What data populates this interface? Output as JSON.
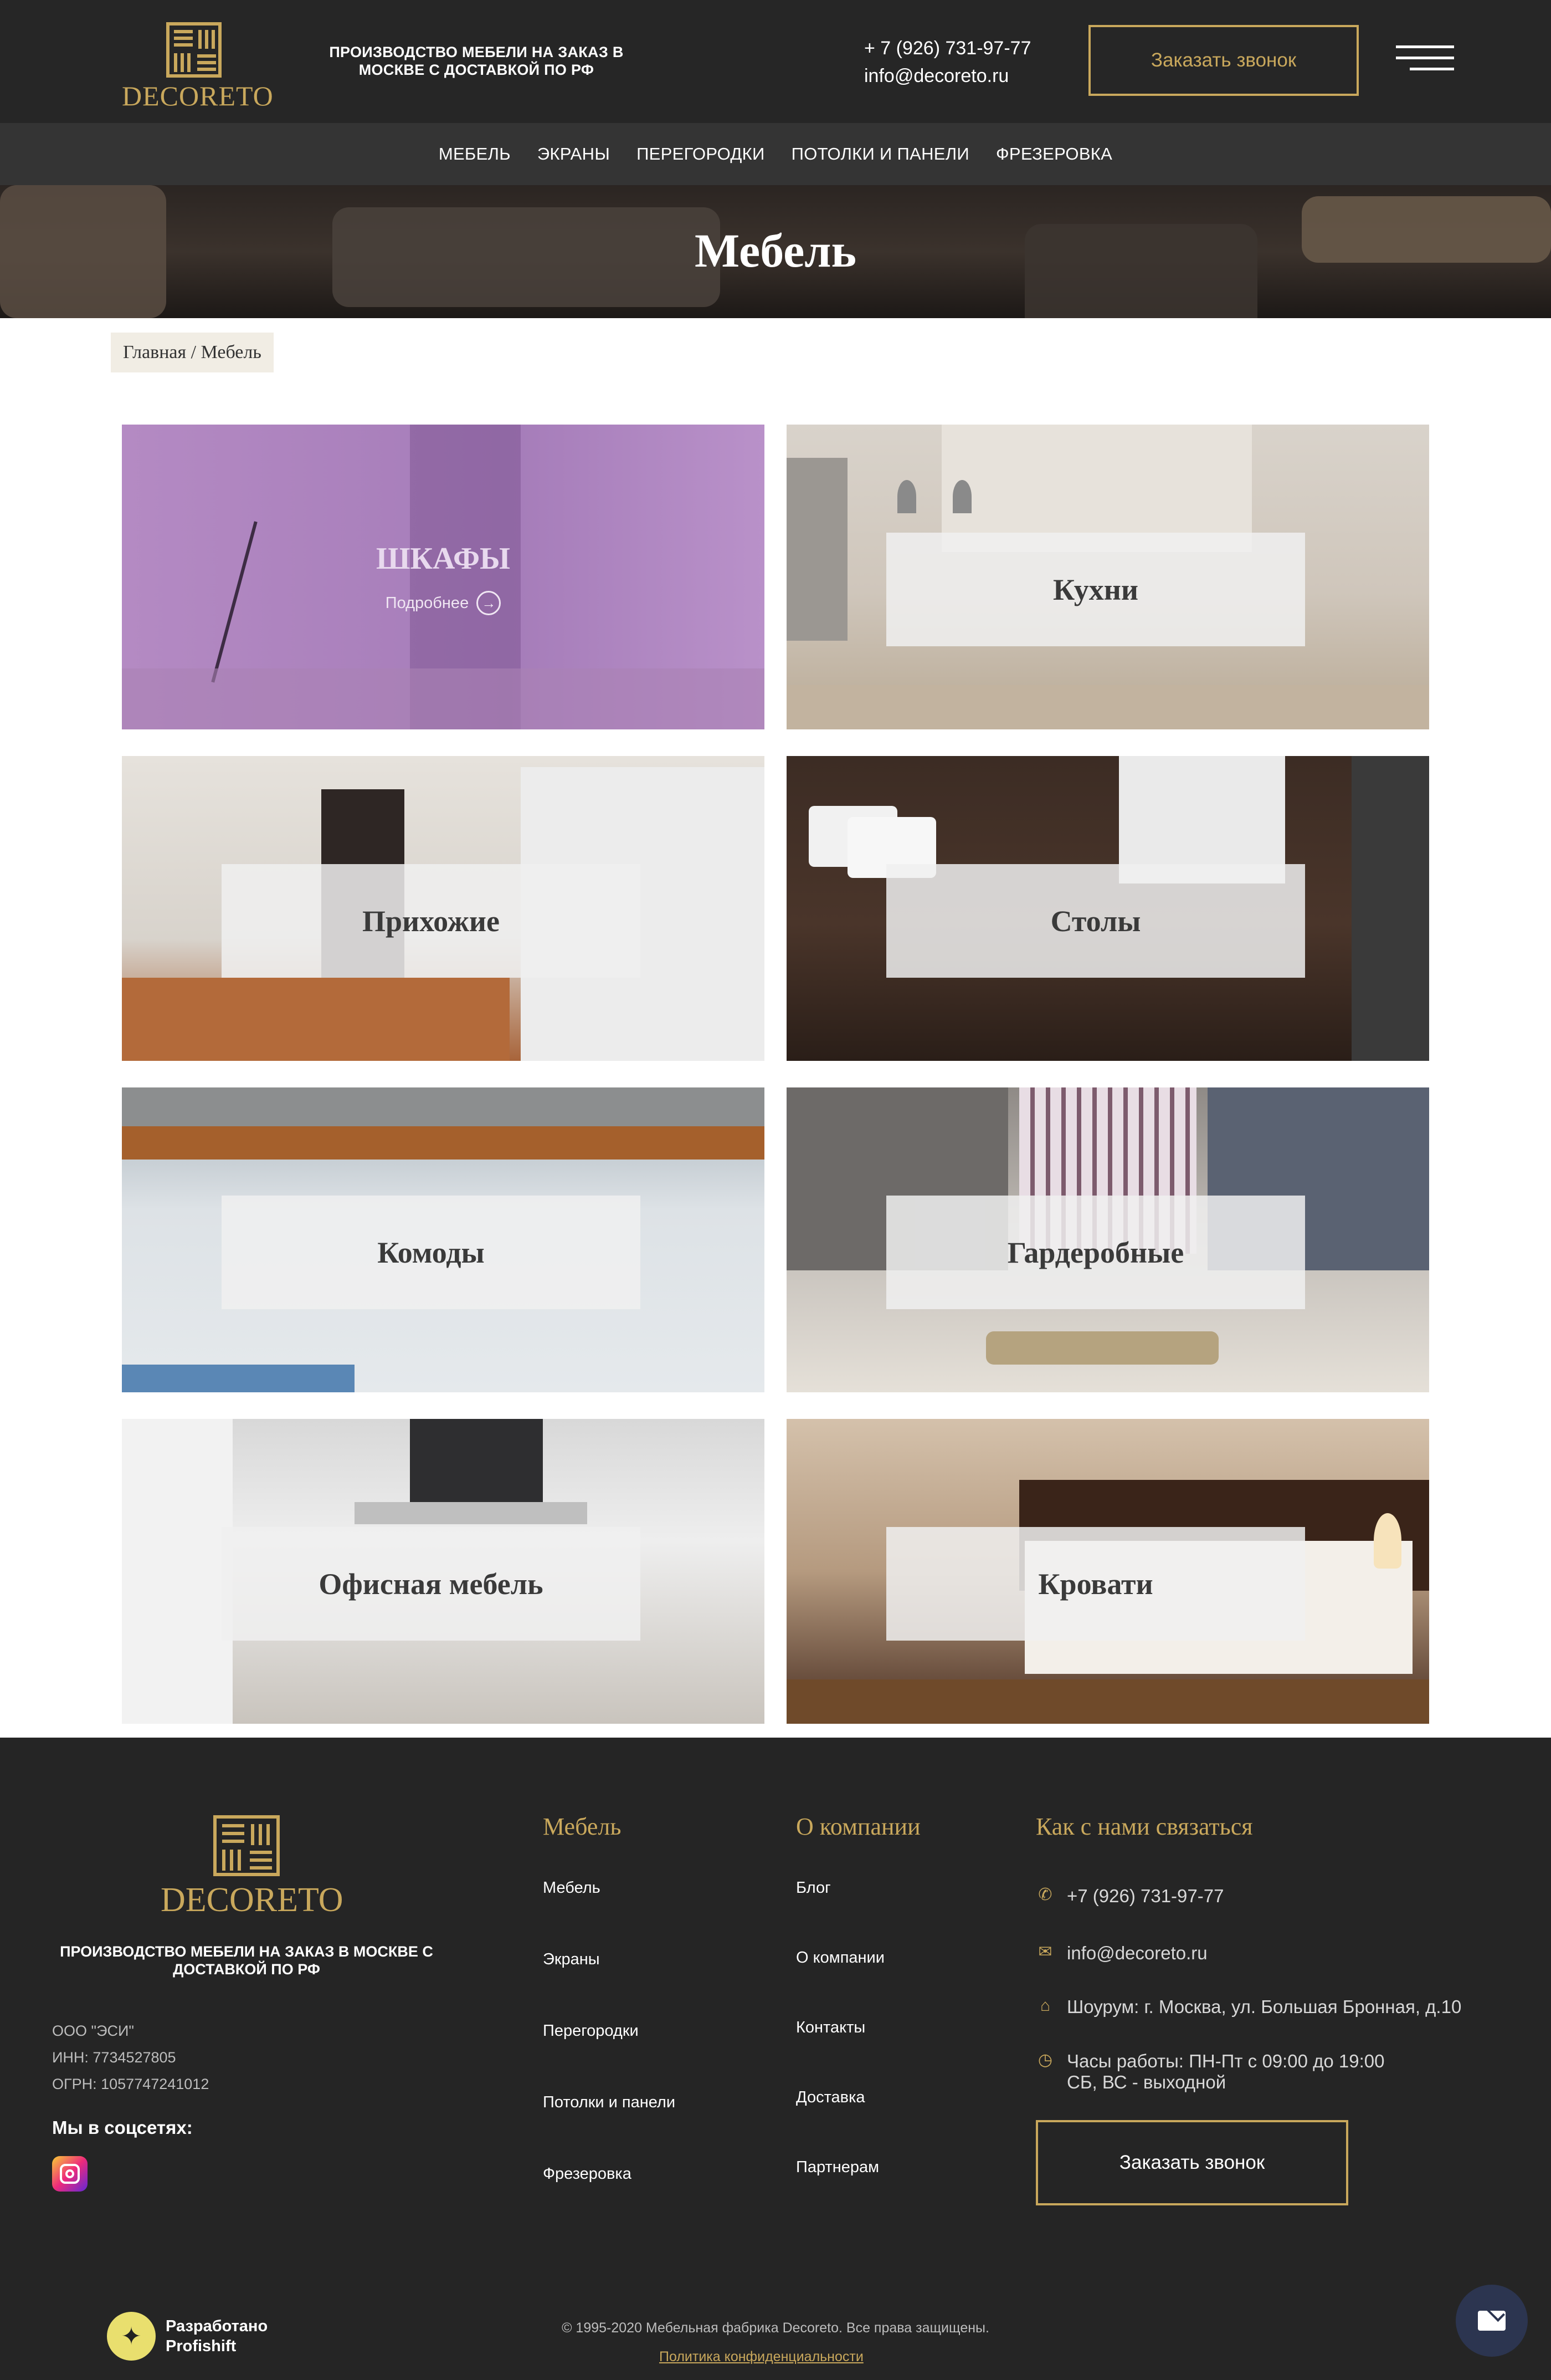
{
  "brand": {
    "logo_text": "DECORETO",
    "accent_color": "#c9a85c"
  },
  "header": {
    "tagline": "ПРОИЗВОДСТВО МЕБЕЛИ НА ЗАКАЗ В МОСКВЕ С ДОСТАВКОЙ ПО РФ",
    "phone": "+ 7 (926) 731-97-77",
    "email": "info@decoreto.ru",
    "callback_label": "Заказать звонок",
    "menu_icon": "hamburger-icon"
  },
  "nav": {
    "items": [
      {
        "label": "МЕБЕЛЬ"
      },
      {
        "label": "ЭКРАНЫ"
      },
      {
        "label": "ПЕРЕГОРОДКИ"
      },
      {
        "label": "ПОТОЛКИ И ПАНЕЛИ"
      },
      {
        "label": "ФРЕЗЕРОВКА"
      }
    ]
  },
  "hero": {
    "title": "Мебель"
  },
  "breadcrumb": {
    "text": "Главная / Мебель"
  },
  "categories": [
    {
      "title": "ШКАФЫ",
      "more": "Подробнее",
      "active": true
    },
    {
      "title": "Кухни"
    },
    {
      "title": "Прихожие"
    },
    {
      "title": "Столы"
    },
    {
      "title": "Комоды"
    },
    {
      "title": "Гардеробные"
    },
    {
      "title": "Офисная мебель"
    },
    {
      "title": "Кровати"
    }
  ],
  "footer": {
    "logo_text": "DECORETO",
    "tagline": "ПРОИЗВОДСТВО МЕБЕЛИ НА ЗАКАЗ В МОСКВЕ С ДОСТАВКОЙ ПО РФ",
    "company": "ООО \"ЭСИ\"",
    "inn": "ИНН: 7734527805",
    "ogrn": "ОГРН: 1057747241012",
    "social_label": "Мы в соцсетях:",
    "social_icon": "instagram-icon",
    "col1": {
      "title": "Мебель",
      "links": [
        "Мебель",
        "Экраны",
        "Перегородки",
        "Потолки и панели",
        "Фрезеровка"
      ]
    },
    "col2": {
      "title": "О компании",
      "links": [
        "Блог",
        "О компании",
        "Контакты",
        "Доставка",
        "Партнерам"
      ]
    },
    "contacts": {
      "title": "Как с нами связаться",
      "phone": "+7 (926) 731-97-77",
      "email": "info@decoreto.ru",
      "showroom": "Шоурум: г. Москва, ул. Большая Бронная, д.10",
      "hours_1": "Часы работы: ПН-Пт с 09:00 до 19:00",
      "hours_2": "СБ, ВС - выходной",
      "callback_label": "Заказать звонок"
    },
    "developer": {
      "line1": "Разработано",
      "line2": "Profishift"
    },
    "copyright": "© 1995-2020 Мебельная фабрика Decoreto. Все права защищены.",
    "privacy": "Политика конфиденциальности"
  }
}
